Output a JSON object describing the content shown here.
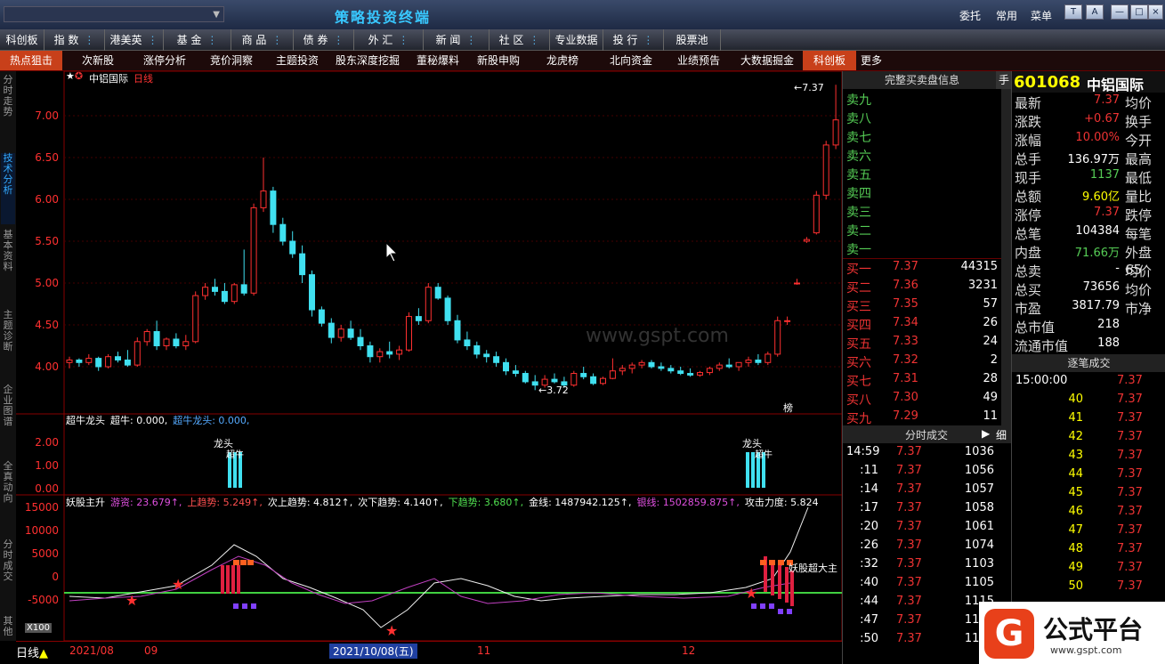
{
  "title": {
    "app": "策略投资终端",
    "right": [
      "委托",
      "常用",
      "菜单"
    ],
    "win": [
      "T",
      "A",
      "—",
      "□",
      "×"
    ]
  },
  "menu1": [
    {
      "label": "科创板",
      "dots": false
    },
    {
      "label": "指 数",
      "dots": true
    },
    {
      "label": "港美英",
      "dots": true
    },
    {
      "label": "基 金",
      "dots": true
    },
    {
      "label": "商 品",
      "dots": true
    },
    {
      "label": "债 券",
      "dots": true
    },
    {
      "label": "外 汇",
      "dots": true
    },
    {
      "label": "新 闻",
      "dots": true
    },
    {
      "label": "社 区",
      "dots": true
    },
    {
      "label": "专业数据",
      "dots": false
    },
    {
      "label": "投 行",
      "dots": true
    },
    {
      "label": "股票池",
      "dots": false
    }
  ],
  "menu2": [
    "热点狙击",
    "次新股",
    "涨停分析",
    "竞价洞察",
    "主题投资",
    "股东深度挖掘",
    "董秘爆料",
    "新股申购",
    "龙虎榜",
    "北向资金",
    "业绩预告",
    "大数据掘金",
    "科创板",
    "更多"
  ],
  "sidebar": [
    "分时走势",
    "技术分析",
    "基本资料",
    "主题诊断",
    "企业图谱",
    "全真动向",
    "分时成交",
    "其他"
  ],
  "stock": {
    "code": "601068",
    "name": "中铝国际",
    "chart_title": "中铝国际",
    "period": "日线",
    "high_mark": "7.37",
    "low_mark": "3.72",
    "watermark": "www.gspt.com",
    "bang": "榜"
  },
  "panel2": {
    "title": "超牛龙头",
    "items": [
      {
        "t": "超牛: 0.000,",
        "c": "#ffffff"
      },
      {
        "t": "超牛龙头: 0.000,",
        "c": "#5af"
      }
    ],
    "labels": [
      "龙头",
      "超牛"
    ],
    "ticks": [
      "2.00",
      "1.00",
      "0.00"
    ]
  },
  "panel3": {
    "title": "妖股主升",
    "items": [
      {
        "t": "游资: 23.679↑,",
        "c": "#e050e0"
      },
      {
        "t": "上趋势: 5.249↑,",
        "c": "#ff5050"
      },
      {
        "t": "次上趋势: 4.812↑,",
        "c": "#ffffff"
      },
      {
        "t": "次下趋势: 4.140↑,",
        "c": "#ffffff"
      },
      {
        "t": "下趋势: 3.680↑,",
        "c": "#50e050"
      },
      {
        "t": "金线: 1487942.125↑,",
        "c": "#ffffff"
      },
      {
        "t": "银线: 1502859.875↑,",
        "c": "#e050e0"
      },
      {
        "t": "攻击力度: 5.824",
        "c": "#ffffff"
      }
    ],
    "label": "妖股超大主",
    "ticks": [
      "15000",
      "10000",
      "5000",
      "0",
      "-5000"
    ],
    "x100": "X100"
  },
  "price_ticks": [
    "7.00",
    "6.50",
    "6.00",
    "5.50",
    "5.00",
    "4.50",
    "4.00"
  ],
  "datebar": {
    "period": "日线",
    "dates": [
      "2021/08",
      "09",
      "2021/10/08(五)",
      "11",
      "12"
    ]
  },
  "quote": {
    "header": "完整买卖盘信息",
    "hand": "手",
    "sell": [
      "卖九",
      "卖八",
      "卖七",
      "卖六",
      "卖五",
      "卖四",
      "卖三",
      "卖二",
      "卖一"
    ],
    "buy": [
      {
        "l": "买一",
        "p": "7.37",
        "v": "44315"
      },
      {
        "l": "买二",
        "p": "7.36",
        "v": "3231"
      },
      {
        "l": "买三",
        "p": "7.35",
        "v": "57"
      },
      {
        "l": "买四",
        "p": "7.34",
        "v": "26"
      },
      {
        "l": "买五",
        "p": "7.33",
        "v": "24"
      },
      {
        "l": "买六",
        "p": "7.32",
        "v": "2"
      },
      {
        "l": "买七",
        "p": "7.31",
        "v": "28"
      },
      {
        "l": "买八",
        "p": "7.30",
        "v": "49"
      },
      {
        "l": "买九",
        "p": "7.29",
        "v": "11"
      }
    ]
  },
  "info": [
    {
      "l": "最新",
      "v": "7.37",
      "c": "#e33",
      "l2": "均价"
    },
    {
      "l": "涨跌",
      "v": "+0.67",
      "c": "#e33",
      "l2": "换手"
    },
    {
      "l": "涨幅",
      "v": "10.00%",
      "c": "#e33",
      "l2": "今开"
    },
    {
      "l": "总手",
      "v": "136.97万",
      "c": "#fff",
      "l2": "最高"
    },
    {
      "l": "现手",
      "v": "1137",
      "c": "#5c5",
      "l2": "最低"
    },
    {
      "l": "总额",
      "v": "9.60亿",
      "c": "#ff0",
      "l2": "量比"
    },
    {
      "l": "涨停",
      "v": "7.37",
      "c": "#e33",
      "l2": "跌停"
    },
    {
      "l": "总笔",
      "v": "104384",
      "c": "#fff",
      "l2": "每笔"
    },
    {
      "l": "内盘",
      "v": "71.66万",
      "c": "#5c5",
      "l2": "外盘 65"
    },
    {
      "l": "总卖",
      "v": "-",
      "c": "#fff",
      "l2": "均价"
    },
    {
      "l": "总买",
      "v": "73656",
      "c": "#fff",
      "l2": "均价"
    },
    {
      "l": "市盈",
      "v": "3817.79",
      "c": "#fff",
      "l2": "市净"
    },
    {
      "l": "总市值",
      "v": "218",
      "c": "#fff",
      "l2": ""
    },
    {
      "l": "流通市值",
      "v": "188",
      "c": "#fff",
      "l2": ""
    }
  ],
  "ticks": {
    "header": "分时成交",
    "detail": "细",
    "rows": [
      {
        "t": "14:59",
        "p": "7.37",
        "v": "1036"
      },
      {
        "t": ":11",
        "p": "7.37",
        "v": "1056"
      },
      {
        "t": ":14",
        "p": "7.37",
        "v": "1057"
      },
      {
        "t": ":17",
        "p": "7.37",
        "v": "1058"
      },
      {
        "t": ":20",
        "p": "7.37",
        "v": "1061"
      },
      {
        "t": ":26",
        "p": "7.37",
        "v": "1074"
      },
      {
        "t": ":32",
        "p": "7.37",
        "v": "1103"
      },
      {
        "t": ":40",
        "p": "7.37",
        "v": "1105"
      },
      {
        "t": ":44",
        "p": "7.37",
        "v": "1115"
      },
      {
        "t": ":47",
        "p": "7.37",
        "v": "1136"
      },
      {
        "t": ":50",
        "p": "7.37",
        "v": "1137"
      }
    ]
  },
  "trades": {
    "header": "逐笔成交",
    "rows": [
      {
        "t": "15:00:00",
        "v": "",
        "p": "7.37"
      },
      {
        "t": "",
        "v": "40",
        "p": "7.37"
      },
      {
        "t": "",
        "v": "41",
        "p": "7.37"
      },
      {
        "t": "",
        "v": "42",
        "p": "7.37"
      },
      {
        "t": "",
        "v": "43",
        "p": "7.37"
      },
      {
        "t": "",
        "v": "44",
        "p": "7.37"
      },
      {
        "t": "",
        "v": "45",
        "p": "7.37"
      },
      {
        "t": "",
        "v": "46",
        "p": "7.37"
      },
      {
        "t": "",
        "v": "47",
        "p": "7.37"
      },
      {
        "t": "",
        "v": "48",
        "p": "7.37"
      },
      {
        "t": "",
        "v": "49",
        "p": "7.37"
      },
      {
        "t": "",
        "v": "50",
        "p": "7.37"
      }
    ]
  },
  "logo": {
    "text": "公式平台",
    "url": "www.gspt.com"
  },
  "candles": [
    [
      4.05,
      4.12,
      3.98,
      4.08
    ],
    [
      4.08,
      4.1,
      4.0,
      4.05
    ],
    [
      4.05,
      4.15,
      4.02,
      4.1
    ],
    [
      4.1,
      4.12,
      3.95,
      4.0
    ],
    [
      4.0,
      4.15,
      3.98,
      4.12
    ],
    [
      4.12,
      4.18,
      4.05,
      4.08
    ],
    [
      4.08,
      4.2,
      4.0,
      4.02
    ],
    [
      4.02,
      4.35,
      4.0,
      4.3
    ],
    [
      4.3,
      4.45,
      4.25,
      4.42
    ],
    [
      4.42,
      4.55,
      4.2,
      4.25
    ],
    [
      4.25,
      4.35,
      4.2,
      4.33
    ],
    [
      4.33,
      4.4,
      4.22,
      4.25
    ],
    [
      4.25,
      4.38,
      4.2,
      4.3
    ],
    [
      4.3,
      4.9,
      4.28,
      4.85
    ],
    [
      4.85,
      5.0,
      4.8,
      4.95
    ],
    [
      4.95,
      5.05,
      4.85,
      4.9
    ],
    [
      4.9,
      5.0,
      4.75,
      4.78
    ],
    [
      4.78,
      5.0,
      4.75,
      4.98
    ],
    [
      4.98,
      5.4,
      4.85,
      4.88
    ],
    [
      4.88,
      5.95,
      4.85,
      5.9
    ],
    [
      5.9,
      6.5,
      5.85,
      6.1
    ],
    [
      6.1,
      6.15,
      5.6,
      5.7
    ],
    [
      5.7,
      5.78,
      5.45,
      5.5
    ],
    [
      5.5,
      5.62,
      5.3,
      5.35
    ],
    [
      5.35,
      5.45,
      5.0,
      5.1
    ],
    [
      5.1,
      5.15,
      4.6,
      4.68
    ],
    [
      4.68,
      4.72,
      4.48,
      4.52
    ],
    [
      4.52,
      4.58,
      4.28,
      4.35
    ],
    [
      4.35,
      4.5,
      4.3,
      4.45
    ],
    [
      4.45,
      4.55,
      4.32,
      4.35
    ],
    [
      4.35,
      4.45,
      4.2,
      4.25
    ],
    [
      4.25,
      4.3,
      4.05,
      4.12
    ],
    [
      4.12,
      4.22,
      4.05,
      4.18
    ],
    [
      4.18,
      4.3,
      4.1,
      4.15
    ],
    [
      4.15,
      4.25,
      4.08,
      4.2
    ],
    [
      4.2,
      4.65,
      4.18,
      4.6
    ],
    [
      4.6,
      4.7,
      4.5,
      4.55
    ],
    [
      4.55,
      5.0,
      4.52,
      4.95
    ],
    [
      4.95,
      5.0,
      4.8,
      4.82
    ],
    [
      4.82,
      4.85,
      4.5,
      4.55
    ],
    [
      4.55,
      4.62,
      4.28,
      4.32
    ],
    [
      4.32,
      4.42,
      4.2,
      4.25
    ],
    [
      4.25,
      4.3,
      4.1,
      4.15
    ],
    [
      4.15,
      4.2,
      4.05,
      4.12
    ],
    [
      4.12,
      4.18,
      4.0,
      4.05
    ],
    [
      4.05,
      4.1,
      3.9,
      3.95
    ],
    [
      3.95,
      4.02,
      3.88,
      3.92
    ],
    [
      3.92,
      3.95,
      3.8,
      3.82
    ],
    [
      3.82,
      3.9,
      3.72,
      3.78
    ],
    [
      3.78,
      3.9,
      3.75,
      3.85
    ],
    [
      3.85,
      3.92,
      3.8,
      3.82
    ],
    [
      3.82,
      3.88,
      3.75,
      3.78
    ],
    [
      3.78,
      3.95,
      3.76,
      3.92
    ],
    [
      3.92,
      4.0,
      3.85,
      3.88
    ],
    [
      3.88,
      3.92,
      3.78,
      3.8
    ],
    [
      3.8,
      3.88,
      3.78,
      3.86
    ],
    [
      3.86,
      4.1,
      3.85,
      3.95
    ],
    [
      3.95,
      4.02,
      3.9,
      3.98
    ],
    [
      3.98,
      4.05,
      3.92,
      4.02
    ],
    [
      4.02,
      4.08,
      3.98,
      4.05
    ],
    [
      4.05,
      4.08,
      3.98,
      4.0
    ],
    [
      4.0,
      4.05,
      3.95,
      3.98
    ],
    [
      3.98,
      4.02,
      3.92,
      3.95
    ],
    [
      3.95,
      4.0,
      3.9,
      3.92
    ],
    [
      3.92,
      3.98,
      3.88,
      3.9
    ],
    [
      3.9,
      3.95,
      3.88,
      3.93
    ],
    [
      3.93,
      4.0,
      3.9,
      3.98
    ],
    [
      3.98,
      4.05,
      3.95,
      4.02
    ],
    [
      4.02,
      4.1,
      3.98,
      4.0
    ],
    [
      4.0,
      4.05,
      3.95,
      4.05
    ],
    [
      4.05,
      4.12,
      4.0,
      4.08
    ],
    [
      4.08,
      4.15,
      4.02,
      4.05
    ],
    [
      4.05,
      4.18,
      4.02,
      4.15
    ],
    [
      4.15,
      4.6,
      4.12,
      4.55
    ],
    [
      4.55,
      4.6,
      4.5,
      4.55
    ],
    [
      5.0,
      5.05,
      4.98,
      5.0
    ],
    [
      5.5,
      5.55,
      5.48,
      5.52
    ],
    [
      5.6,
      6.1,
      5.58,
      6.05
    ],
    [
      6.05,
      6.7,
      6.0,
      6.65
    ],
    [
      6.65,
      7.37,
      6.6,
      6.95
    ],
    [
      6.95,
      7.37,
      6.9,
      7.37
    ]
  ]
}
